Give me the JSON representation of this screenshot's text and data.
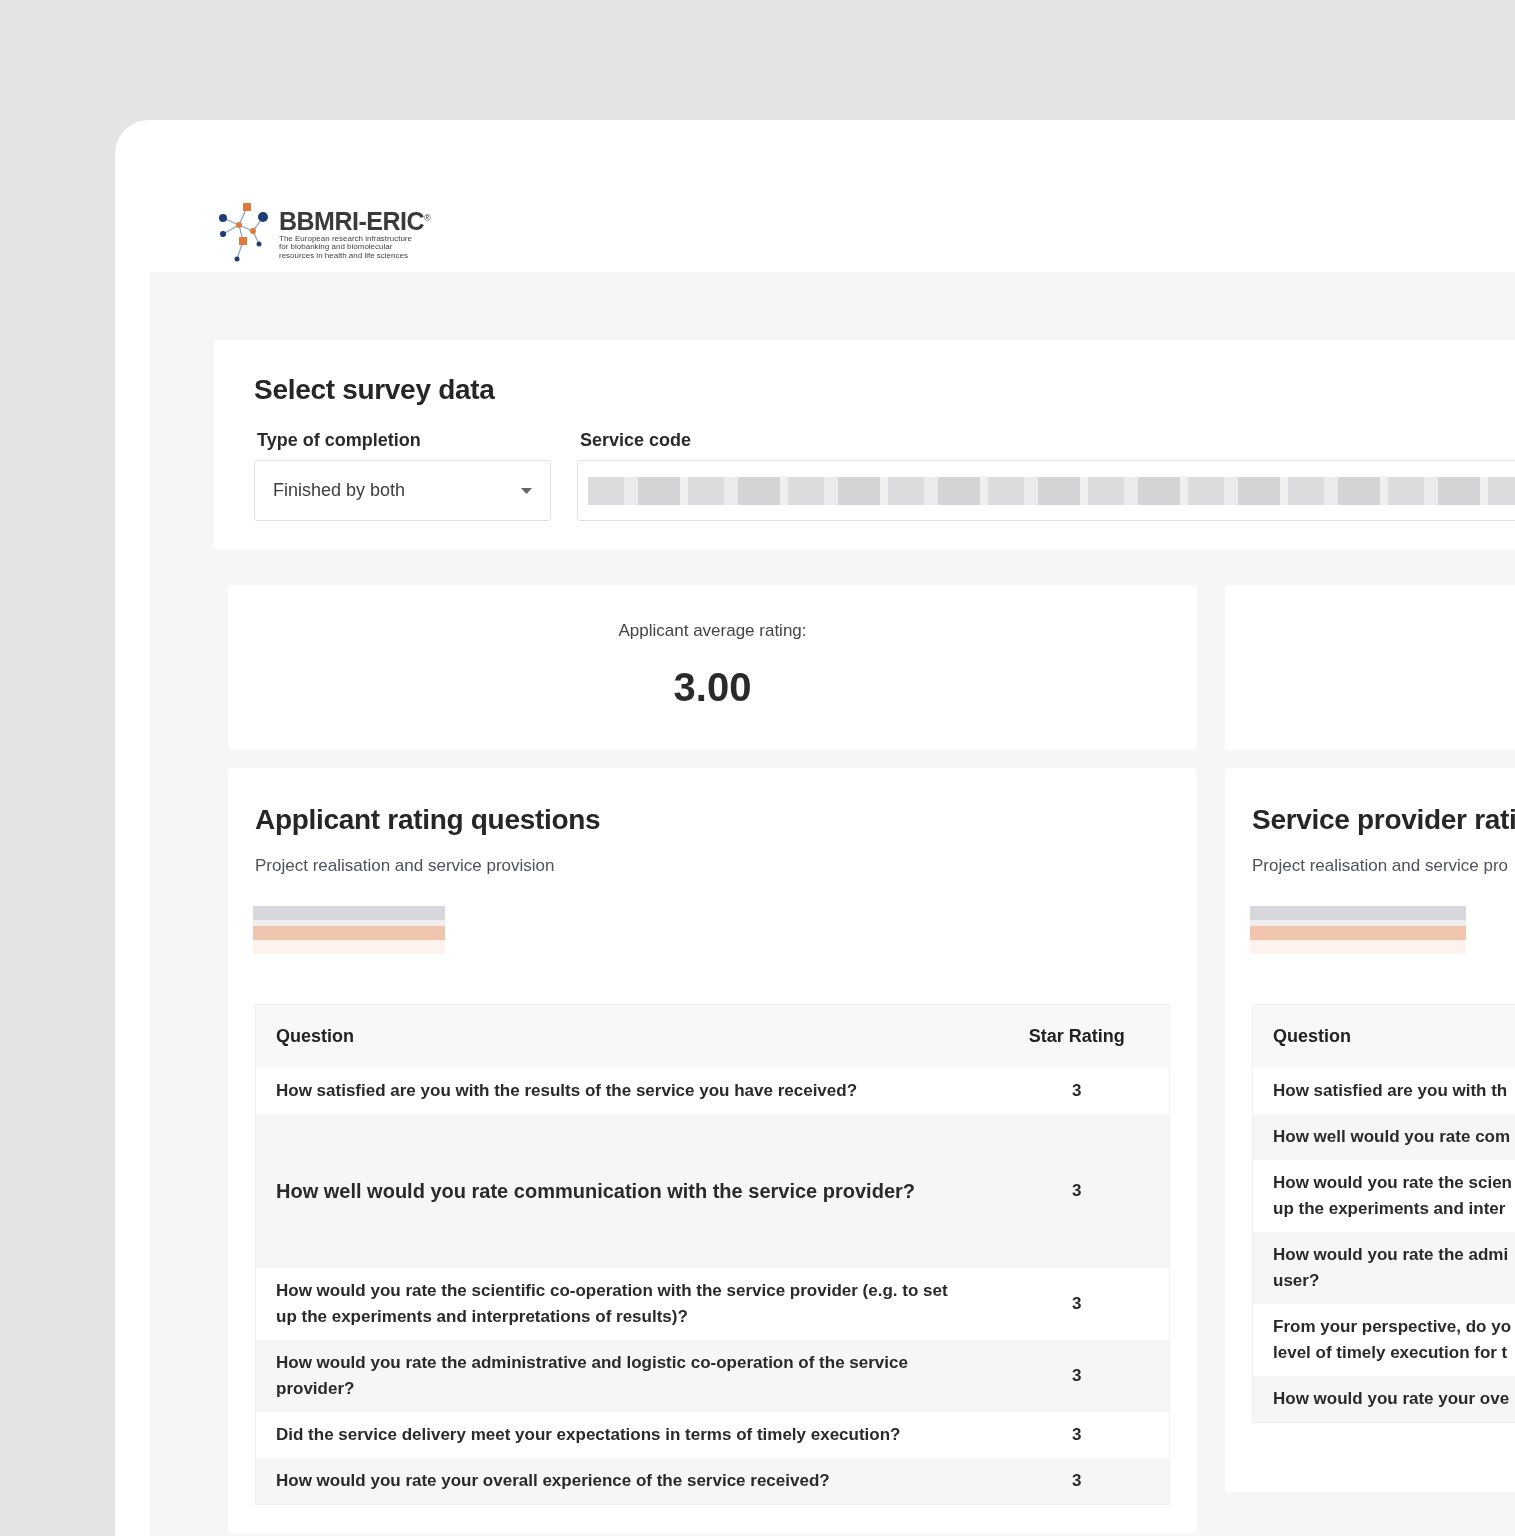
{
  "logo": {
    "name": "BBMRI-ERIC$^{®}$",
    "tagline": [
      "The European research infrastructure",
      "for biobanking and biomolecular",
      "resources in health and life sciences"
    ]
  },
  "filters": {
    "title": "Select survey data",
    "fields": [
      {
        "label": "Type of completion",
        "kind": "select",
        "value": "Finished by both"
      },
      {
        "label": "Service code",
        "kind": "redacted"
      }
    ]
  },
  "average": {
    "label": "Applicant average rating:",
    "value": "3.00"
  },
  "applicant": {
    "title": "Applicant rating questions",
    "subtitle": "Project realisation and service provision",
    "columns": [
      "Question",
      "Star Rating"
    ],
    "rows": [
      {
        "question": "How satisfied are you with the results of the service you have received?",
        "rating": "3",
        "emphasized": false
      },
      {
        "question": "How well would you rate communication with the service provider?",
        "rating": "3",
        "emphasized": true
      },
      {
        "question": "How would you rate the scientific co-operation with the service provider (e.g. to set up the experiments and interpretations of results)?",
        "rating": "3",
        "emphasized": false
      },
      {
        "question": "How would you rate the administrative and logistic co-operation of the service provider?",
        "rating": "3",
        "emphasized": false
      },
      {
        "question": "Did the service delivery meet your expectations in terms of timely execution?",
        "rating": "3",
        "emphasized": false
      },
      {
        "question": "How would you rate your overall experience of the service received?",
        "rating": "3",
        "emphasized": false
      }
    ]
  },
  "provider": {
    "title": "Service provider rati",
    "subtitle": "Project realisation and service pro",
    "columns": [
      "Question"
    ],
    "rows": [
      {
        "lines": [
          "How satisfied are you with th"
        ]
      },
      {
        "lines": [
          "How well would you rate com"
        ]
      },
      {
        "lines": [
          "How would you rate the scien",
          "up the experiments and inter"
        ]
      },
      {
        "lines": [
          "How would you rate the admi",
          "user?"
        ]
      },
      {
        "lines": [
          "From your perspective, do yo",
          "level of timely execution for t"
        ]
      },
      {
        "lines": [
          "How would you rate your ove"
        ]
      }
    ]
  }
}
